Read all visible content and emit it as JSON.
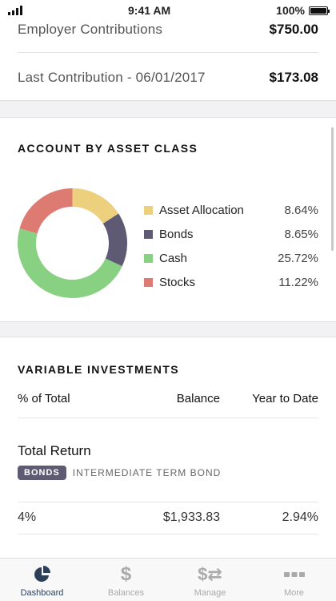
{
  "status": {
    "time": "9:41 AM",
    "battery": "100%"
  },
  "summary": {
    "employer_label": "Employer Contributions",
    "employer_value": "$750.00",
    "last_label": "Last Contribution - 06/01/2017",
    "last_value": "$173.08"
  },
  "allocation": {
    "title": "ACCOUNT BY ASSET CLASS",
    "items": [
      {
        "name": "Asset Allocation",
        "pct": "8.64%",
        "value": 8.64,
        "color": "#edd07e"
      },
      {
        "name": "Bonds",
        "pct": "8.65%",
        "value": 8.65,
        "color": "#5e5a74"
      },
      {
        "name": "Cash",
        "pct": "25.72%",
        "value": 25.72,
        "color": "#88d183"
      },
      {
        "name": "Stocks",
        "pct": "11.22%",
        "value": 11.22,
        "color": "#dd7b72"
      }
    ]
  },
  "investments": {
    "title": "VARIABLE INVESTMENTS",
    "col_pct": "% of Total",
    "col_balance": "Balance",
    "col_ytd": "Year to Date",
    "fund": {
      "name": "Total Return",
      "badge": "BONDS",
      "type": "INTERMEDIATE TERM BOND",
      "pct": "4%",
      "balance": "$1,933.83",
      "ytd": "2.94%"
    }
  },
  "tabs": [
    {
      "label": "Dashboard",
      "icon": "pie-chart-icon",
      "active": true
    },
    {
      "label": "Balances",
      "icon": "dollar-icon",
      "active": false
    },
    {
      "label": "Manage",
      "icon": "dollar-transfer-icon",
      "active": false
    },
    {
      "label": "More",
      "icon": "more-dots-icon",
      "active": false
    }
  ]
}
